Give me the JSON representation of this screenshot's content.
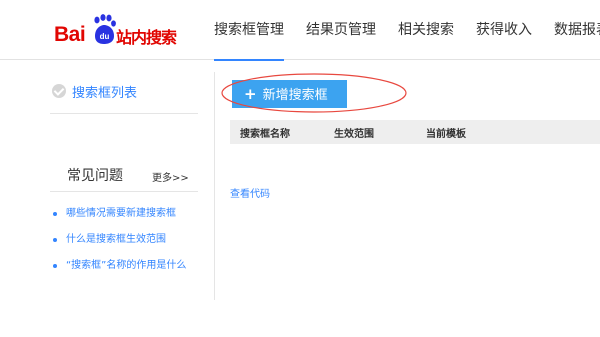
{
  "header": {
    "logo": {
      "text_bai": "Bai",
      "text_du": "du",
      "product": "站内搜索"
    },
    "nav": [
      {
        "label": "搜索框管理",
        "active": true
      },
      {
        "label": "结果页管理",
        "active": false
      },
      {
        "label": "相关搜索",
        "active": false
      },
      {
        "label": "获得收入",
        "active": false
      },
      {
        "label": "数据报表",
        "active": false
      }
    ]
  },
  "sidebar": {
    "title": "搜索框列表",
    "faq_title": "常见问题",
    "faq_more": "更多>>",
    "faq_items": [
      "哪些情况需要新建搜索框",
      "什么是搜索框生效范围",
      "“搜索框”名称的作用是什么"
    ]
  },
  "main": {
    "add_button": "新增搜索框",
    "table_headers": [
      "搜索框名称",
      "生效范围",
      "当前模板"
    ],
    "view_code": "查看代码"
  },
  "colors": {
    "brand_red": "#e10602",
    "brand_blue": "#2932e1",
    "link_blue": "#3385ff",
    "button_blue": "#3ca3f0",
    "annotation_red": "#e8483f"
  },
  "icons": {
    "logo_paw": "paw-icon",
    "sidebar_check": "check-circle-icon",
    "add_button": "plus-icon",
    "faq_bullet": "bullet-icon"
  }
}
